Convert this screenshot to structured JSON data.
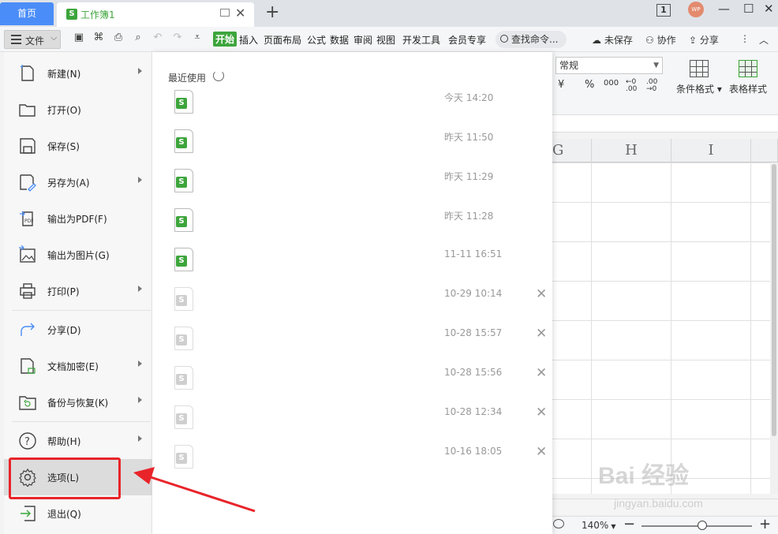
{
  "titlebar": {
    "home_tab": "首页",
    "doc_tab": "工作簿1",
    "doc_tab_icon": "S",
    "window_num": "1",
    "avatar": "WP"
  },
  "toolbar": {
    "file_menu_label": "文件",
    "ribbon_tabs": [
      "开始",
      "插入",
      "页面布局",
      "公式",
      "数据",
      "审阅",
      "视图",
      "开发工具",
      "会员专享"
    ],
    "search_placeholder": "查找命令...",
    "unsaved": "未保存",
    "collab": "协作",
    "share": "分享"
  },
  "ribbon": {
    "number_format": "常规",
    "format_icons": [
      "¥",
      "%",
      "000",
      "←0 .00",
      ".00 →0"
    ],
    "cond_format": "条件格式",
    "table_style": "表格样式"
  },
  "sheet": {
    "columns": [
      "G",
      "H",
      "I"
    ],
    "zoom": "140%"
  },
  "file_menu": {
    "items": [
      {
        "label": "新建(N)",
        "has_submenu": true
      },
      {
        "label": "打开(O)",
        "has_submenu": false
      },
      {
        "label": "保存(S)",
        "has_submenu": false
      },
      {
        "label": "另存为(A)",
        "has_submenu": true
      },
      {
        "label": "输出为PDF(F)",
        "has_submenu": false
      },
      {
        "label": "输出为图片(G)",
        "has_submenu": false
      },
      {
        "label": "打印(P)",
        "has_submenu": true
      },
      {
        "label": "分享(D)",
        "has_submenu": false
      },
      {
        "label": "文档加密(E)",
        "has_submenu": true
      },
      {
        "label": "备份与恢复(K)",
        "has_submenu": true
      },
      {
        "label": "帮助(H)",
        "has_submenu": true
      },
      {
        "label": "选项(L)",
        "has_submenu": false,
        "selected": true
      },
      {
        "label": "退出(Q)",
        "has_submenu": false
      }
    ]
  },
  "recent": {
    "title": "最近使用",
    "files": [
      {
        "time": "今天 14:20",
        "active": true,
        "removable": false
      },
      {
        "time": "昨天 11:50",
        "active": true,
        "removable": false
      },
      {
        "time": "昨天 11:29",
        "active": true,
        "removable": false
      },
      {
        "time": "昨天 11:28",
        "active": true,
        "removable": false
      },
      {
        "time": "11-11 16:51",
        "active": true,
        "removable": false
      },
      {
        "time": "10-29 10:14",
        "active": false,
        "removable": true
      },
      {
        "time": "10-28 15:57",
        "active": false,
        "removable": true
      },
      {
        "time": "10-28 15:56",
        "active": false,
        "removable": true
      },
      {
        "time": "10-28 12:34",
        "active": false,
        "removable": true
      },
      {
        "time": "10-16 18:05",
        "active": false,
        "removable": true
      }
    ]
  },
  "watermark": {
    "main": "Bai 经验",
    "sub": "jingyan.baidu.com"
  },
  "colors": {
    "accent_green": "#3da53c",
    "home_blue": "#4b8df8",
    "highlight_red": "#e8242a"
  }
}
